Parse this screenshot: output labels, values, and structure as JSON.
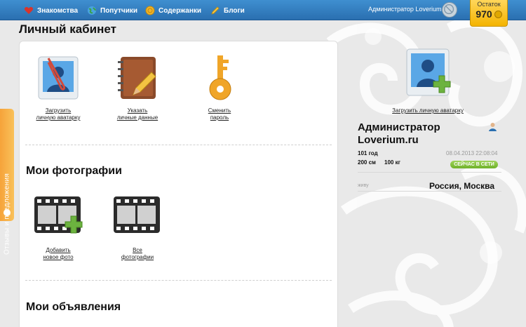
{
  "nav": {
    "items": [
      {
        "label": "Знакомства",
        "icon": "heart-icon",
        "color": "#d9342b"
      },
      {
        "label": "Попутчики",
        "icon": "globe-icon",
        "color": "#3aa24a"
      },
      {
        "label": "Содержанки",
        "icon": "coins-icon",
        "color": "#f0b429"
      },
      {
        "label": "Блоги",
        "icon": "pencil-icon",
        "color": "#f3c342"
      }
    ],
    "admin_label": "Администратор Loverium.ru",
    "balance_label": "Остаток",
    "balance_value": "970"
  },
  "page_title": "Личный кабинет",
  "cabinet": {
    "upload_avatar": "Загрузить\nличную аватарку",
    "personal_data": "Указать\nличные данные",
    "change_password": "Сменить\nпароль"
  },
  "photos": {
    "title": "Мои фотографии",
    "add_photo": "Добавить\nновое фото",
    "all_photos": "Все\nфотографии"
  },
  "ads": {
    "title": "Мои объявления"
  },
  "feedback_label": "Отзывы и предложения",
  "profile": {
    "upload_avatar_label": "Загрузить личную аватарку",
    "name": "Администратор Loverium.ru",
    "age": "101 год",
    "height": "200 см",
    "weight": "100 кг",
    "date": "08.04.2013 22:08:04",
    "online_badge": "СЕЙЧАС В СЕТИ",
    "lives_label": "живу",
    "lives_value": "Россия, Москва"
  },
  "colors": {
    "topbar": "#3380c4",
    "accent_orange": "#f6a33a",
    "online_green": "#7cbc34"
  }
}
